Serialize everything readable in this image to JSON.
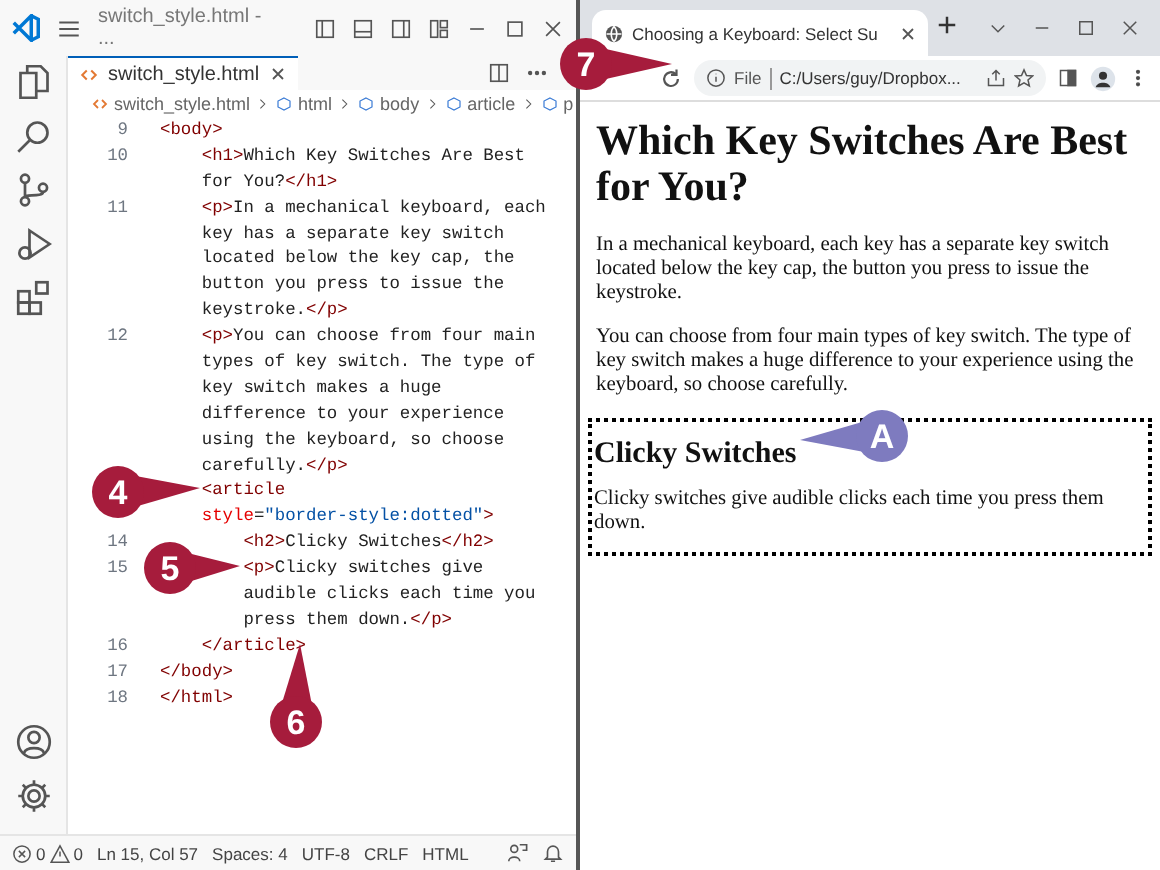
{
  "editor": {
    "title": "switch_style.html - ...",
    "tab": {
      "label": "switch_style.html",
      "selected": true
    },
    "breadcrumb": [
      "switch_style.html",
      "html",
      "body",
      "article",
      "p"
    ],
    "lines": [
      {
        "number": "9",
        "rows": [
          [
            {
              "kind": "tag",
              "text": "<body>"
            }
          ]
        ]
      },
      {
        "number": "10",
        "rows": [
          [
            {
              "kind": "tag",
              "text": "    <h1>"
            },
            {
              "kind": "text",
              "text": "Which Key Switches Are Best"
            }
          ],
          [
            {
              "kind": "text",
              "text": "    for You?"
            },
            {
              "kind": "tag",
              "text": "</h1>"
            }
          ]
        ]
      },
      {
        "number": "11",
        "rows": [
          [
            {
              "kind": "tag",
              "text": "    <p>"
            },
            {
              "kind": "text",
              "text": "In a mechanical keyboard, each"
            }
          ],
          [
            {
              "kind": "text",
              "text": "    key has a separate key switch"
            }
          ],
          [
            {
              "kind": "text",
              "text": "    located below the key cap, the"
            }
          ],
          [
            {
              "kind": "text",
              "text": "    button you press to issue the"
            }
          ],
          [
            {
              "kind": "text",
              "text": "    keystroke."
            },
            {
              "kind": "tag",
              "text": "</p>"
            }
          ]
        ]
      },
      {
        "number": "12",
        "rows": [
          [
            {
              "kind": "tag",
              "text": "    <p>"
            },
            {
              "kind": "text",
              "text": "You can choose from four main"
            }
          ],
          [
            {
              "kind": "text",
              "text": "    types of key switch. The type of"
            }
          ],
          [
            {
              "kind": "text",
              "text": "    key switch makes a huge"
            }
          ],
          [
            {
              "kind": "text",
              "text": "    difference to your experience"
            }
          ],
          [
            {
              "kind": "text",
              "text": "    using the keyboard, so choose"
            }
          ],
          [
            {
              "kind": "text",
              "text": "    carefully."
            },
            {
              "kind": "tag",
              "text": "</p>"
            }
          ]
        ]
      },
      {
        "rows": [
          [
            {
              "kind": "tag",
              "text": "    <article"
            }
          ],
          [
            {
              "kind": "attr",
              "text": "    style"
            },
            {
              "kind": "text",
              "text": "="
            },
            {
              "kind": "value",
              "text": "\"border-style:dotted\""
            },
            {
              "kind": "tag",
              "text": ">"
            }
          ]
        ]
      },
      {
        "number": "14",
        "rows": [
          [
            {
              "kind": "tag",
              "text": "        <h2>"
            },
            {
              "kind": "text",
              "text": "Clicky Switches"
            },
            {
              "kind": "tag",
              "text": "</h2>"
            }
          ]
        ]
      },
      {
        "number": "15",
        "rows": [
          [
            {
              "kind": "tag",
              "text": "        <p>"
            },
            {
              "kind": "text",
              "text": "Clicky switches give"
            }
          ],
          [
            {
              "kind": "text",
              "text": "        audible clicks each time you"
            }
          ],
          [
            {
              "kind": "text",
              "text": "        press them down."
            },
            {
              "kind": "tag",
              "text": "</p>"
            }
          ]
        ]
      },
      {
        "number": "16",
        "rows": [
          [
            {
              "kind": "tag",
              "text": "    </article>"
            }
          ]
        ]
      },
      {
        "number": "17",
        "rows": [
          [
            {
              "kind": "tag",
              "text": "</body>"
            }
          ]
        ]
      },
      {
        "number": "18",
        "rows": [
          [
            {
              "kind": "tag",
              "text": "</html>"
            }
          ]
        ]
      }
    ],
    "status": {
      "errors": "0",
      "warnings": "0",
      "position": "Ln 15, Col 57",
      "spaces": "Spaces: 4",
      "encoding": "UTF-8",
      "eol": "CRLF",
      "language": "HTML"
    }
  },
  "browser": {
    "tab": {
      "label": "Choosing a Keyboard: Select Su",
      "selected": true
    },
    "address": {
      "scheme": "File",
      "url": "C:/Users/guy/Dropbox..."
    },
    "page": {
      "heading": "Which Key Switches Are Best for You?",
      "paragraphs": [
        "In a mechanical keyboard, each key has a separate key switch located below the key cap, the button you press to issue the keystroke.",
        "You can choose from four main types of key switch. The type of key switch makes a huge difference to your experience using the keyboard, so choose carefully."
      ],
      "article": {
        "heading": "Clicky Switches",
        "text": "Clicky switches give audible clicks each time you press them down."
      }
    }
  },
  "callouts": [
    {
      "label": "4",
      "color": "#a61c3c"
    },
    {
      "label": "5",
      "color": "#a61c3c"
    },
    {
      "label": "6",
      "color": "#a61c3c"
    },
    {
      "label": "7",
      "color": "#a61c3c"
    },
    {
      "label": "A",
      "color": "#7e7bbf"
    }
  ]
}
